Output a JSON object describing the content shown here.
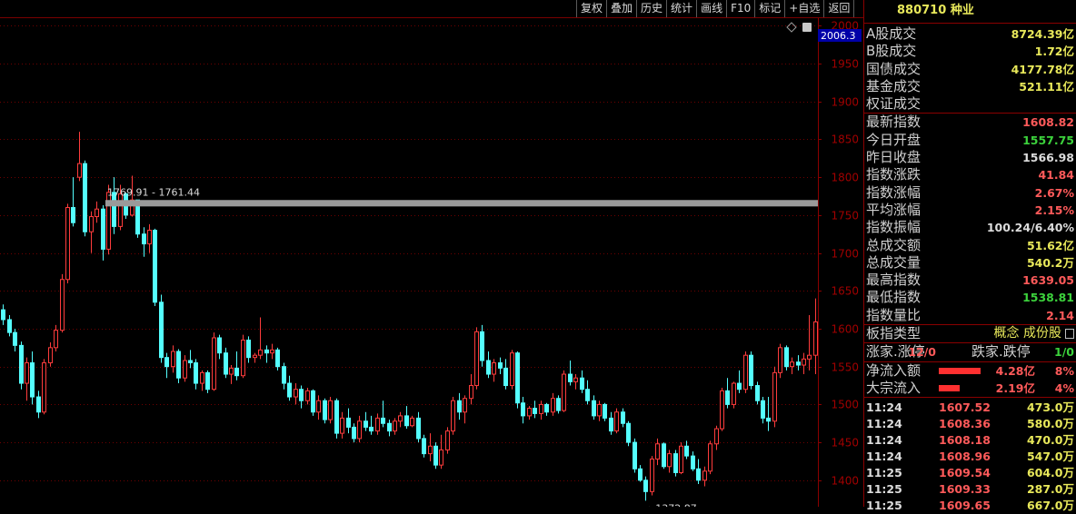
{
  "toolbar": {
    "buttons": [
      "复权",
      "叠加",
      "历史",
      "统计",
      "画线",
      "F10",
      "标记",
      "+自选",
      "返回"
    ]
  },
  "chart": {
    "axis_badge": "2006.3",
    "corner_icon": "diamond-icon",
    "high_line_label": "1769.91 - 1761.44",
    "low_label": "←1372.87"
  },
  "chart_data": {
    "type": "candlestick",
    "ylim": [
      1365,
      2010
    ],
    "y_ticks": [
      1400,
      1450,
      1500,
      1550,
      1600,
      1650,
      1700,
      1750,
      1800,
      1850,
      1900,
      1950,
      2000
    ],
    "hline_range": [
      1761.44,
      1769.91
    ],
    "candles": [
      [
        1625,
        1632,
        1605,
        1612
      ],
      [
        1612,
        1618,
        1590,
        1595
      ],
      [
        1595,
        1600,
        1570,
        1578
      ],
      [
        1578,
        1583,
        1520,
        1528
      ],
      [
        1528,
        1562,
        1505,
        1555
      ],
      [
        1555,
        1570,
        1500,
        1510
      ],
      [
        1510,
        1518,
        1482,
        1490
      ],
      [
        1490,
        1560,
        1487,
        1555
      ],
      [
        1555,
        1582,
        1550,
        1575
      ],
      [
        1575,
        1605,
        1570,
        1598
      ],
      [
        1598,
        1672,
        1595,
        1665
      ],
      [
        1665,
        1765,
        1660,
        1760
      ],
      [
        1760,
        1800,
        1735,
        1740
      ],
      [
        1800,
        1860,
        1795,
        1818
      ],
      [
        1818,
        1822,
        1722,
        1728
      ],
      [
        1728,
        1755,
        1700,
        1748
      ],
      [
        1748,
        1768,
        1740,
        1758
      ],
      [
        1758,
        1763,
        1690,
        1705
      ],
      [
        1705,
        1790,
        1698,
        1780
      ],
      [
        1780,
        1800,
        1725,
        1735
      ],
      [
        1735,
        1790,
        1730,
        1778
      ],
      [
        1778,
        1780,
        1745,
        1750
      ],
      [
        1750,
        1802,
        1748,
        1770
      ],
      [
        1770,
        1770,
        1720,
        1725
      ],
      [
        1725,
        1734,
        1695,
        1712
      ],
      [
        1712,
        1738,
        1700,
        1730
      ],
      [
        1730,
        1732,
        1630,
        1635
      ],
      [
        1635,
        1645,
        1555,
        1562
      ],
      [
        1562,
        1568,
        1535,
        1550
      ],
      [
        1550,
        1578,
        1542,
        1570
      ],
      [
        1570,
        1573,
        1528,
        1535
      ],
      [
        1535,
        1565,
        1530,
        1558
      ],
      [
        1558,
        1572,
        1548,
        1555
      ],
      [
        1555,
        1560,
        1520,
        1528
      ],
      [
        1528,
        1545,
        1518,
        1542
      ],
      [
        1542,
        1545,
        1515,
        1520
      ],
      [
        1520,
        1595,
        1518,
        1588
      ],
      [
        1588,
        1592,
        1560,
        1568
      ],
      [
        1568,
        1575,
        1535,
        1540
      ],
      [
        1540,
        1552,
        1527,
        1548
      ],
      [
        1548,
        1570,
        1532,
        1538
      ],
      [
        1538,
        1592,
        1535,
        1585
      ],
      [
        1585,
        1590,
        1555,
        1562
      ],
      [
        1562,
        1568,
        1555,
        1565
      ],
      [
        1565,
        1615,
        1560,
        1572
      ],
      [
        1572,
        1578,
        1555,
        1568
      ],
      [
        1568,
        1580,
        1560,
        1572
      ],
      [
        1572,
        1575,
        1545,
        1550
      ],
      [
        1550,
        1555,
        1520,
        1528
      ],
      [
        1528,
        1538,
        1505,
        1510
      ],
      [
        1510,
        1528,
        1500,
        1520
      ],
      [
        1520,
        1525,
        1495,
        1505
      ],
      [
        1505,
        1522,
        1500,
        1518
      ],
      [
        1518,
        1520,
        1485,
        1490
      ],
      [
        1490,
        1512,
        1480,
        1505
      ],
      [
        1505,
        1508,
        1475,
        1480
      ],
      [
        1480,
        1510,
        1475,
        1505
      ],
      [
        1505,
        1508,
        1455,
        1462
      ],
      [
        1462,
        1490,
        1455,
        1482
      ],
      [
        1482,
        1495,
        1462,
        1470
      ],
      [
        1470,
        1475,
        1450,
        1455
      ],
      [
        1455,
        1485,
        1450,
        1478
      ],
      [
        1478,
        1490,
        1465,
        1470
      ],
      [
        1470,
        1485,
        1460,
        1465
      ],
      [
        1465,
        1488,
        1460,
        1482
      ],
      [
        1482,
        1505,
        1470,
        1475
      ],
      [
        1475,
        1480,
        1458,
        1465
      ],
      [
        1465,
        1482,
        1460,
        1478
      ],
      [
        1478,
        1490,
        1470,
        1485
      ],
      [
        1485,
        1498,
        1468,
        1472
      ],
      [
        1472,
        1485,
        1470,
        1482
      ],
      [
        1482,
        1490,
        1450,
        1455
      ],
      [
        1455,
        1460,
        1430,
        1435
      ],
      [
        1435,
        1462,
        1425,
        1445
      ],
      [
        1445,
        1450,
        1415,
        1420
      ],
      [
        1420,
        1460,
        1415,
        1440
      ],
      [
        1440,
        1470,
        1435,
        1465
      ],
      [
        1465,
        1510,
        1460,
        1505
      ],
      [
        1505,
        1515,
        1480,
        1490
      ],
      [
        1490,
        1512,
        1475,
        1508
      ],
      [
        1508,
        1540,
        1500,
        1525
      ],
      [
        1525,
        1602,
        1520,
        1596
      ],
      [
        1596,
        1605,
        1550,
        1558
      ],
      [
        1558,
        1570,
        1535,
        1540
      ],
      [
        1540,
        1560,
        1530,
        1555
      ],
      [
        1555,
        1562,
        1540,
        1548
      ],
      [
        1548,
        1560,
        1520,
        1525
      ],
      [
        1525,
        1572,
        1520,
        1568
      ],
      [
        1568,
        1570,
        1495,
        1502
      ],
      [
        1502,
        1510,
        1475,
        1485
      ],
      [
        1485,
        1498,
        1480,
        1495
      ],
      [
        1495,
        1505,
        1482,
        1488
      ],
      [
        1488,
        1505,
        1480,
        1500
      ],
      [
        1500,
        1502,
        1485,
        1490
      ],
      [
        1490,
        1515,
        1485,
        1508
      ],
      [
        1508,
        1512,
        1488,
        1492
      ],
      [
        1492,
        1545,
        1490,
        1540
      ],
      [
        1540,
        1558,
        1525,
        1530
      ],
      [
        1530,
        1540,
        1520,
        1535
      ],
      [
        1535,
        1545,
        1515,
        1520
      ],
      [
        1520,
        1532,
        1500,
        1505
      ],
      [
        1505,
        1512,
        1480,
        1485
      ],
      [
        1485,
        1505,
        1478,
        1500
      ],
      [
        1500,
        1502,
        1478,
        1482
      ],
      [
        1482,
        1490,
        1460,
        1465
      ],
      [
        1465,
        1495,
        1462,
        1490
      ],
      [
        1490,
        1495,
        1470,
        1475
      ],
      [
        1475,
        1478,
        1445,
        1450
      ],
      [
        1450,
        1455,
        1410,
        1415
      ],
      [
        1415,
        1420,
        1398,
        1400
      ],
      [
        1400,
        1405,
        1373,
        1385
      ],
      [
        1385,
        1432,
        1380,
        1428
      ],
      [
        1428,
        1455,
        1420,
        1448
      ],
      [
        1448,
        1450,
        1415,
        1418
      ],
      [
        1418,
        1440,
        1410,
        1435
      ],
      [
        1435,
        1440,
        1405,
        1410
      ],
      [
        1410,
        1450,
        1408,
        1445
      ],
      [
        1445,
        1452,
        1428,
        1432
      ],
      [
        1432,
        1438,
        1412,
        1415
      ],
      [
        1415,
        1428,
        1395,
        1400
      ],
      [
        1400,
        1418,
        1392,
        1412
      ],
      [
        1412,
        1452,
        1408,
        1448
      ],
      [
        1448,
        1472,
        1440,
        1468
      ],
      [
        1468,
        1522,
        1465,
        1518
      ],
      [
        1518,
        1535,
        1495,
        1500
      ],
      [
        1500,
        1530,
        1495,
        1528
      ],
      [
        1528,
        1545,
        1515,
        1520
      ],
      [
        1520,
        1570,
        1515,
        1565
      ],
      [
        1565,
        1570,
        1520,
        1525
      ],
      [
        1525,
        1530,
        1500,
        1505
      ],
      [
        1505,
        1510,
        1475,
        1482
      ],
      [
        1482,
        1510,
        1465,
        1478
      ],
      [
        1478,
        1550,
        1470,
        1542
      ],
      [
        1542,
        1580,
        1535,
        1575
      ],
      [
        1575,
        1578,
        1545,
        1550
      ],
      [
        1550,
        1562,
        1540,
        1556
      ],
      [
        1556,
        1565,
        1545,
        1552
      ],
      [
        1552,
        1568,
        1540,
        1560
      ],
      [
        1560,
        1618,
        1545,
        1565
      ],
      [
        1565,
        1640,
        1540,
        1609
      ]
    ]
  },
  "panel": {
    "code": "880710",
    "name": "种业",
    "stats1": [
      {
        "label": "A股成交",
        "value": "8724.39亿",
        "color": "yellow"
      },
      {
        "label": "B股成交",
        "value": "1.72亿",
        "color": "yellow"
      },
      {
        "label": "国债成交",
        "value": "4177.78亿",
        "color": "yellow"
      },
      {
        "label": "基金成交",
        "value": "521.11亿",
        "color": "yellow"
      },
      {
        "label": "权证成交",
        "value": "",
        "color": "yellow"
      }
    ],
    "stats2": [
      {
        "label": "最新指数",
        "value": "1608.82",
        "color": "red"
      },
      {
        "label": "今日开盘",
        "value": "1557.75",
        "color": "green"
      },
      {
        "label": "昨日收盘",
        "value": "1566.98",
        "color": "white"
      },
      {
        "label": "指数涨跌",
        "value": "41.84",
        "color": "red"
      },
      {
        "label": "指数涨幅",
        "value": "2.67%",
        "color": "red"
      },
      {
        "label": "平均涨幅",
        "value": "2.15%",
        "color": "red"
      },
      {
        "label": "指数振幅",
        "value": "100.24/6.40%",
        "color": "white"
      },
      {
        "label": "总成交额",
        "value": "51.62亿",
        "color": "yellow"
      },
      {
        "label": "总成交量",
        "value": "540.2万",
        "color": "yellow"
      },
      {
        "label": "最高指数",
        "value": "1639.05",
        "color": "red"
      },
      {
        "label": "最低指数",
        "value": "1538.81",
        "color": "green"
      },
      {
        "label": "指数量比",
        "value": "2.14",
        "color": "red"
      }
    ],
    "board": {
      "label": "板指类型",
      "value": "概念 成份股"
    },
    "updown": {
      "up_label": "涨家.涨停",
      "up_value": "12/0",
      "down_label": "跌家.跌停",
      "down_value": "1/0"
    },
    "flows": [
      {
        "label": "净流入额",
        "value": "4.28亿",
        "pct": "8%",
        "bar": 0.8
      },
      {
        "label": "大宗流入",
        "value": "2.19亿",
        "pct": "4%",
        "bar": 0.4
      }
    ],
    "ticks": [
      {
        "time": "11:24",
        "price": "1607.52",
        "vol": "473.0万"
      },
      {
        "time": "11:24",
        "price": "1608.36",
        "vol": "580.0万"
      },
      {
        "time": "11:24",
        "price": "1608.18",
        "vol": "470.0万"
      },
      {
        "time": "11:24",
        "price": "1608.96",
        "vol": "547.0万"
      },
      {
        "time": "11:25",
        "price": "1609.54",
        "vol": "604.0万"
      },
      {
        "time": "11:25",
        "price": "1609.33",
        "vol": "287.0万"
      },
      {
        "time": "11:25",
        "price": "1609.65",
        "vol": "667.0万"
      }
    ]
  }
}
